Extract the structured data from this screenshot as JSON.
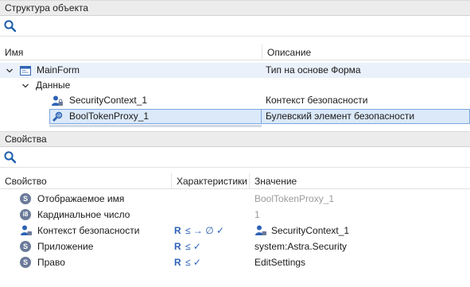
{
  "structure_panel": {
    "title": "Структура объекта",
    "columns": {
      "name": "Имя",
      "description": "Описание"
    },
    "rows": [
      {
        "name": "MainForm",
        "description": "Тип на основе Форма"
      },
      {
        "name": "Данные",
        "description": ""
      },
      {
        "name": "SecurityContext_1",
        "description": "Контекст безопасности"
      },
      {
        "name": "BoolTokenProxy_1",
        "description": "Булевский элемент безопасности"
      }
    ]
  },
  "properties_panel": {
    "title": "Свойства",
    "columns": {
      "property": "Свойство",
      "characteristics": "Характеристики",
      "value": "Значение"
    },
    "rows": [
      {
        "badge": "S",
        "name": "Отображаемое имя",
        "chars": "",
        "value": "BoolTokenProxy_1"
      },
      {
        "badge": "i8",
        "name": "Кардинальное число",
        "chars": "",
        "value": "1"
      },
      {
        "badge": "",
        "name": "Контекст безопасности",
        "chars_r": "R",
        "chars_rest": "≤ → ∅ ✓",
        "value": "SecurityContext_1"
      },
      {
        "badge": "S",
        "name": "Приложение",
        "chars_r": "R",
        "chars_rest": "≤ ✓",
        "value": "system:Astra.Security"
      },
      {
        "badge": "S",
        "name": "Право",
        "chars_r": "R",
        "chars_rest": "≤ ✓",
        "value": "EditSettings"
      }
    ]
  },
  "colors": {
    "accent": "#2c62b5",
    "selection": "#dbe9f9",
    "header_bg": "#ececec"
  }
}
